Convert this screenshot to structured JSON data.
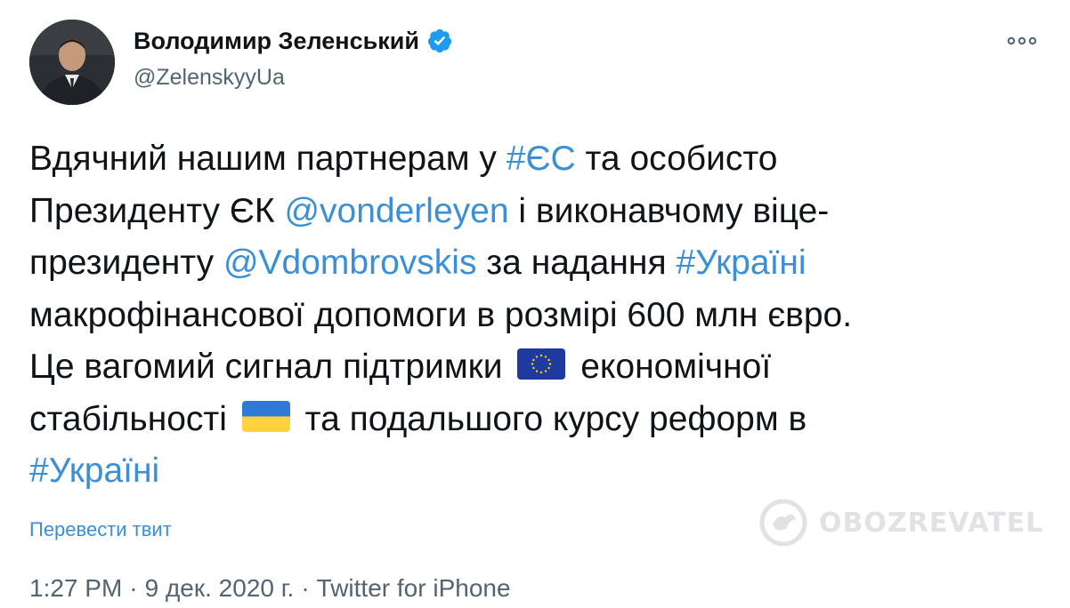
{
  "author": {
    "display_name": "Володимир Зеленський",
    "handle": "@ZelenskyyUa",
    "verified_icon": "verified-badge-icon",
    "avatar_icon": "profile-photo"
  },
  "more_icon": "more-dots-icon",
  "tweet": {
    "l1_a": "Вдячний нашим партнерам у ",
    "l1_tag": "#ЄС",
    "l1_b": " та особисто",
    "l2_a": "Президенту ЄК ",
    "l2_mention": "@vonderleyen",
    "l2_b": " і виконавчому віце-",
    "l3_a": "президенту ",
    "l3_mention": "@Vdombrovskis",
    "l3_b": " за надання ",
    "l3_tag": "#Україні",
    "l4": "макрофінансової допомоги в розмірі 600 млн євро.",
    "l5_a": "Це вагомий сигнал підтримки",
    "l5_b": "економічної",
    "l6_a": "стабільності",
    "l6_b": "та подальшого курсу реформ в",
    "l7_tag": "#Україні",
    "eu_flag": "eu-flag-emoji",
    "ua_flag": "ukraine-flag-emoji"
  },
  "translate_label": "Перевести твит",
  "watermark": "OBOZREVATEL",
  "meta": {
    "time": "1:27 PM",
    "date": "9 дек. 2020 г.",
    "source": "Twitter for iPhone",
    "separator": "·"
  },
  "colors": {
    "link": "#3a8fd6",
    "text": "#0f1419",
    "secondary": "#536471",
    "verified": "#1d9bf0"
  }
}
